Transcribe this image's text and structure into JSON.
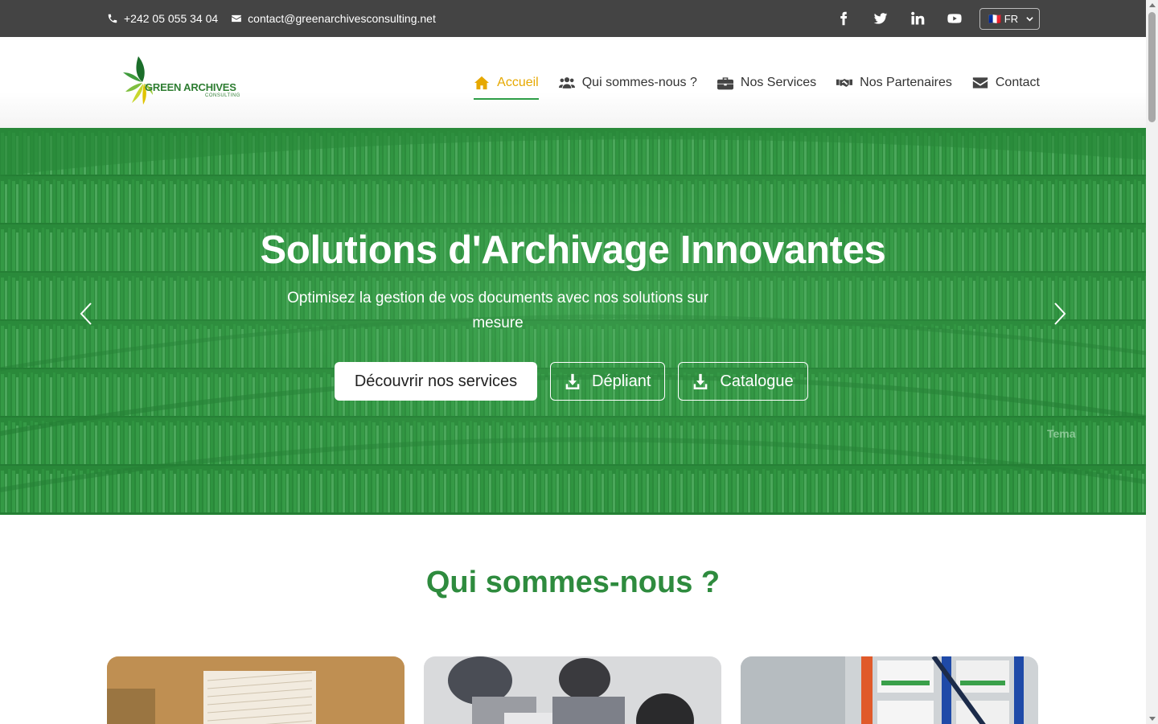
{
  "topbar": {
    "phone": "+242 05 055 34 04",
    "email": "contact@greenarchivesconsulting.net",
    "social_icons": [
      "facebook-icon",
      "twitter-icon",
      "linkedin-icon",
      "youtube-icon"
    ],
    "language": "🇫🇷 FR"
  },
  "logo": {
    "name": "GREEN ARCHIVES",
    "tagline": "CONSULTING"
  },
  "nav": {
    "items": [
      {
        "label": "Accueil",
        "icon": "home-icon",
        "active": true
      },
      {
        "label": "Qui sommes-nous ?",
        "icon": "users-icon"
      },
      {
        "label": "Nos Services",
        "icon": "briefcase-icon"
      },
      {
        "label": "Nos Partenaires",
        "icon": "handshake-icon"
      },
      {
        "label": "Contact",
        "icon": "envelope-icon"
      }
    ]
  },
  "hero": {
    "title": "Solutions d'Archivage Innovantes",
    "subtitle": "Optimisez la gestion de vos documents avec nos solutions sur mesure",
    "buttons": {
      "primary": "Découvrir nos services",
      "depliant": "Dépliant",
      "catalogue": "Catalogue"
    },
    "shelf_sign": "Tema"
  },
  "about": {
    "title": "Qui sommes-nous ?"
  },
  "colors": {
    "topbar": "#444444",
    "accent": "#e6a800",
    "green": "#2e8b3e"
  }
}
